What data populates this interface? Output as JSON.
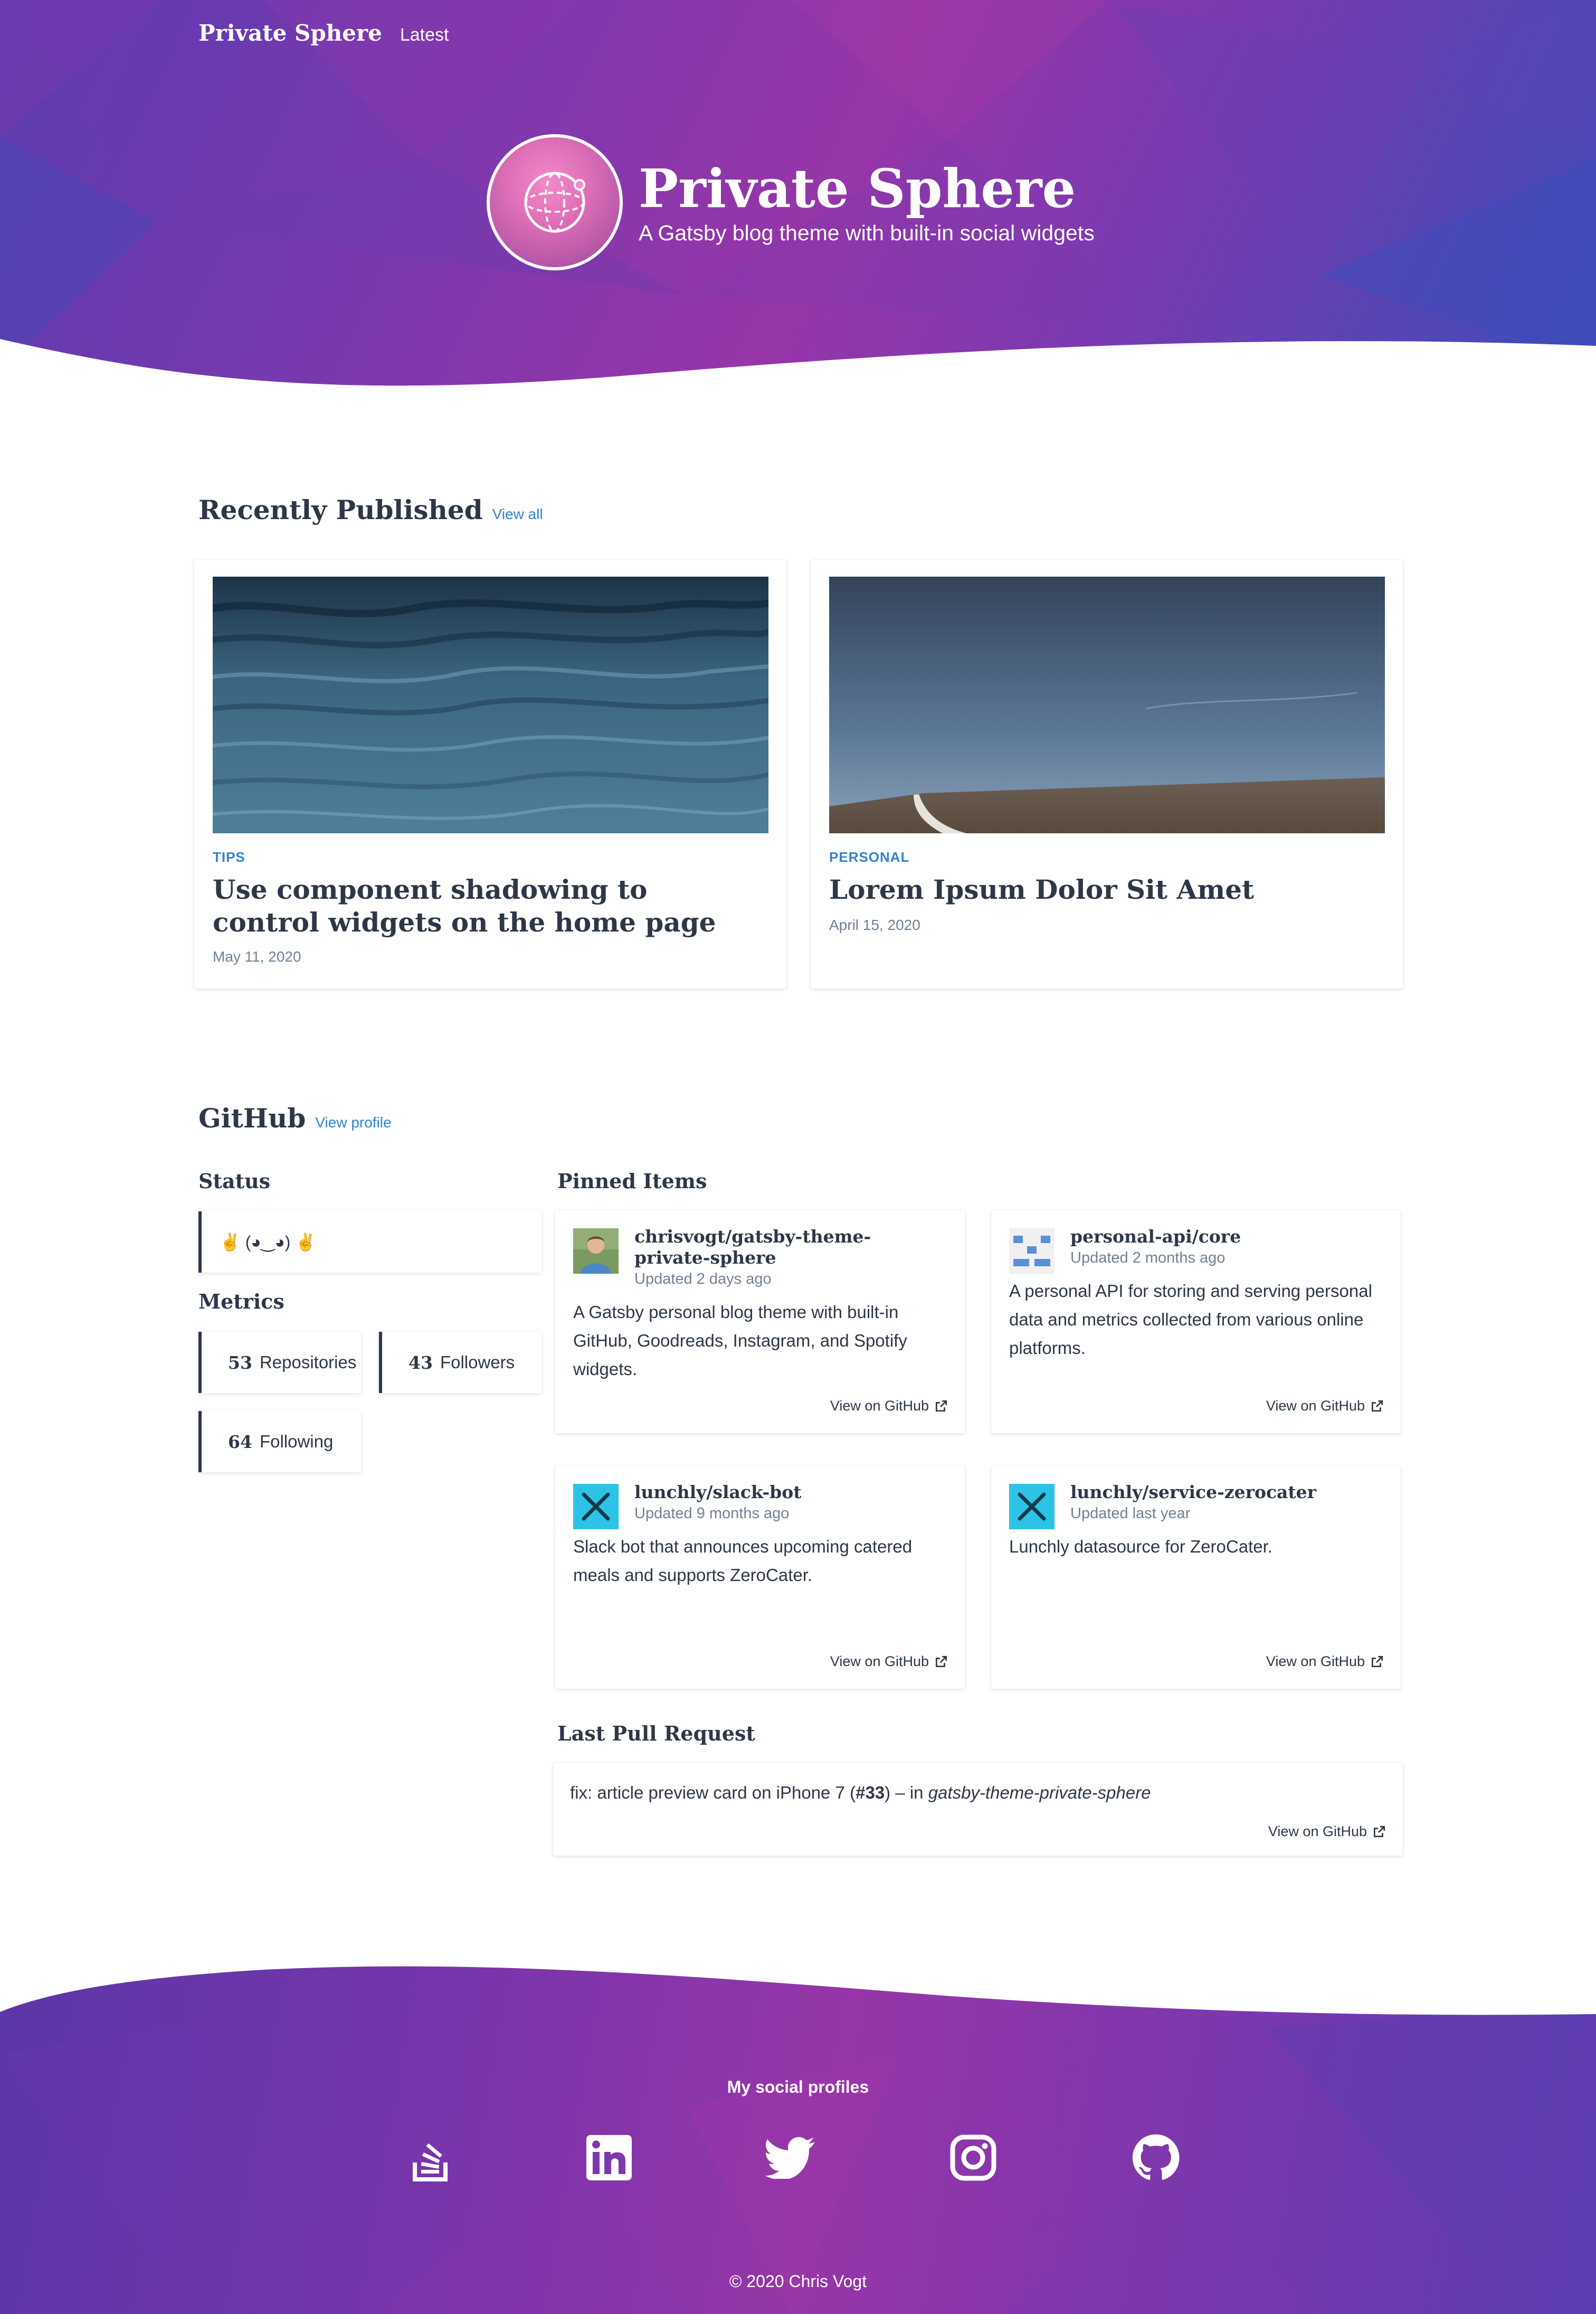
{
  "nav": {
    "brand": "Private Sphere",
    "latest": "Latest"
  },
  "hero": {
    "title": "Private Sphere",
    "subtitle": "A Gatsby blog theme with built-in social widgets"
  },
  "recent": {
    "title": "Recently Published",
    "view_all": "View all",
    "articles": [
      {
        "category": "TIPS",
        "title": "Use component shadowing to control widgets on the home page",
        "date": "May 11, 2020",
        "image": "ocean-water"
      },
      {
        "category": "PERSONAL",
        "title": "Lorem Ipsum Dolor Sit Amet",
        "date": "April 15, 2020",
        "image": "field-road-sky"
      }
    ]
  },
  "github": {
    "title": "GitHub",
    "view_profile": "View profile",
    "status_title": "Status",
    "status_text": "✌️ (◕‿◕) ✌️",
    "metrics_title": "Metrics",
    "metrics": [
      {
        "value": "53",
        "label": "Repositories"
      },
      {
        "value": "43",
        "label": "Followers"
      },
      {
        "value": "64",
        "label": "Following"
      }
    ],
    "pinned_title": "Pinned Items",
    "repos": [
      {
        "name": "chrisvogt/gatsby-theme-private-sphere",
        "updated": "Updated 2 days ago",
        "description": "A Gatsby personal blog theme with built-in GitHub, Goodreads, Instagram, and Spotify widgets.",
        "link": "View on GitHub",
        "avatar": "person-photo"
      },
      {
        "name": "personal-api/core",
        "updated": "Updated 2 months ago",
        "description": "A personal API for storing and serving personal data and metrics collected from various online platforms.",
        "link": "View on GitHub",
        "avatar": "identicon"
      },
      {
        "name": "lunchly/slack-bot",
        "updated": "Updated 9 months ago",
        "description": "Slack bot that announces upcoming catered meals and supports ZeroCater.",
        "link": "View on GitHub",
        "avatar": "fork-knife-logo"
      },
      {
        "name": "lunchly/service-zerocater",
        "updated": "Updated last year",
        "description": "Lunchly datasource for ZeroCater.",
        "link": "View on GitHub",
        "avatar": "fork-knife-logo"
      }
    ],
    "last_pr_title": "Last Pull Request",
    "last_pr": {
      "prefix": "fix: article preview card on iPhone 7 (",
      "number": "#33",
      "middle": ") – in ",
      "repo": "gatsby-theme-private-sphere",
      "link": "View on GitHub"
    }
  },
  "footer": {
    "heading": "My social profiles",
    "profiles": [
      "stack-overflow-icon",
      "linkedin-icon",
      "twitter-icon",
      "instagram-icon",
      "github-icon"
    ],
    "copyright": "© 2020 Chris Vogt"
  },
  "colors": {
    "accent": "#3182ce",
    "text": "#2d3748",
    "muted": "#718096",
    "hero_purple": "#8a37ab",
    "hero_blue": "#3d4bbb"
  }
}
